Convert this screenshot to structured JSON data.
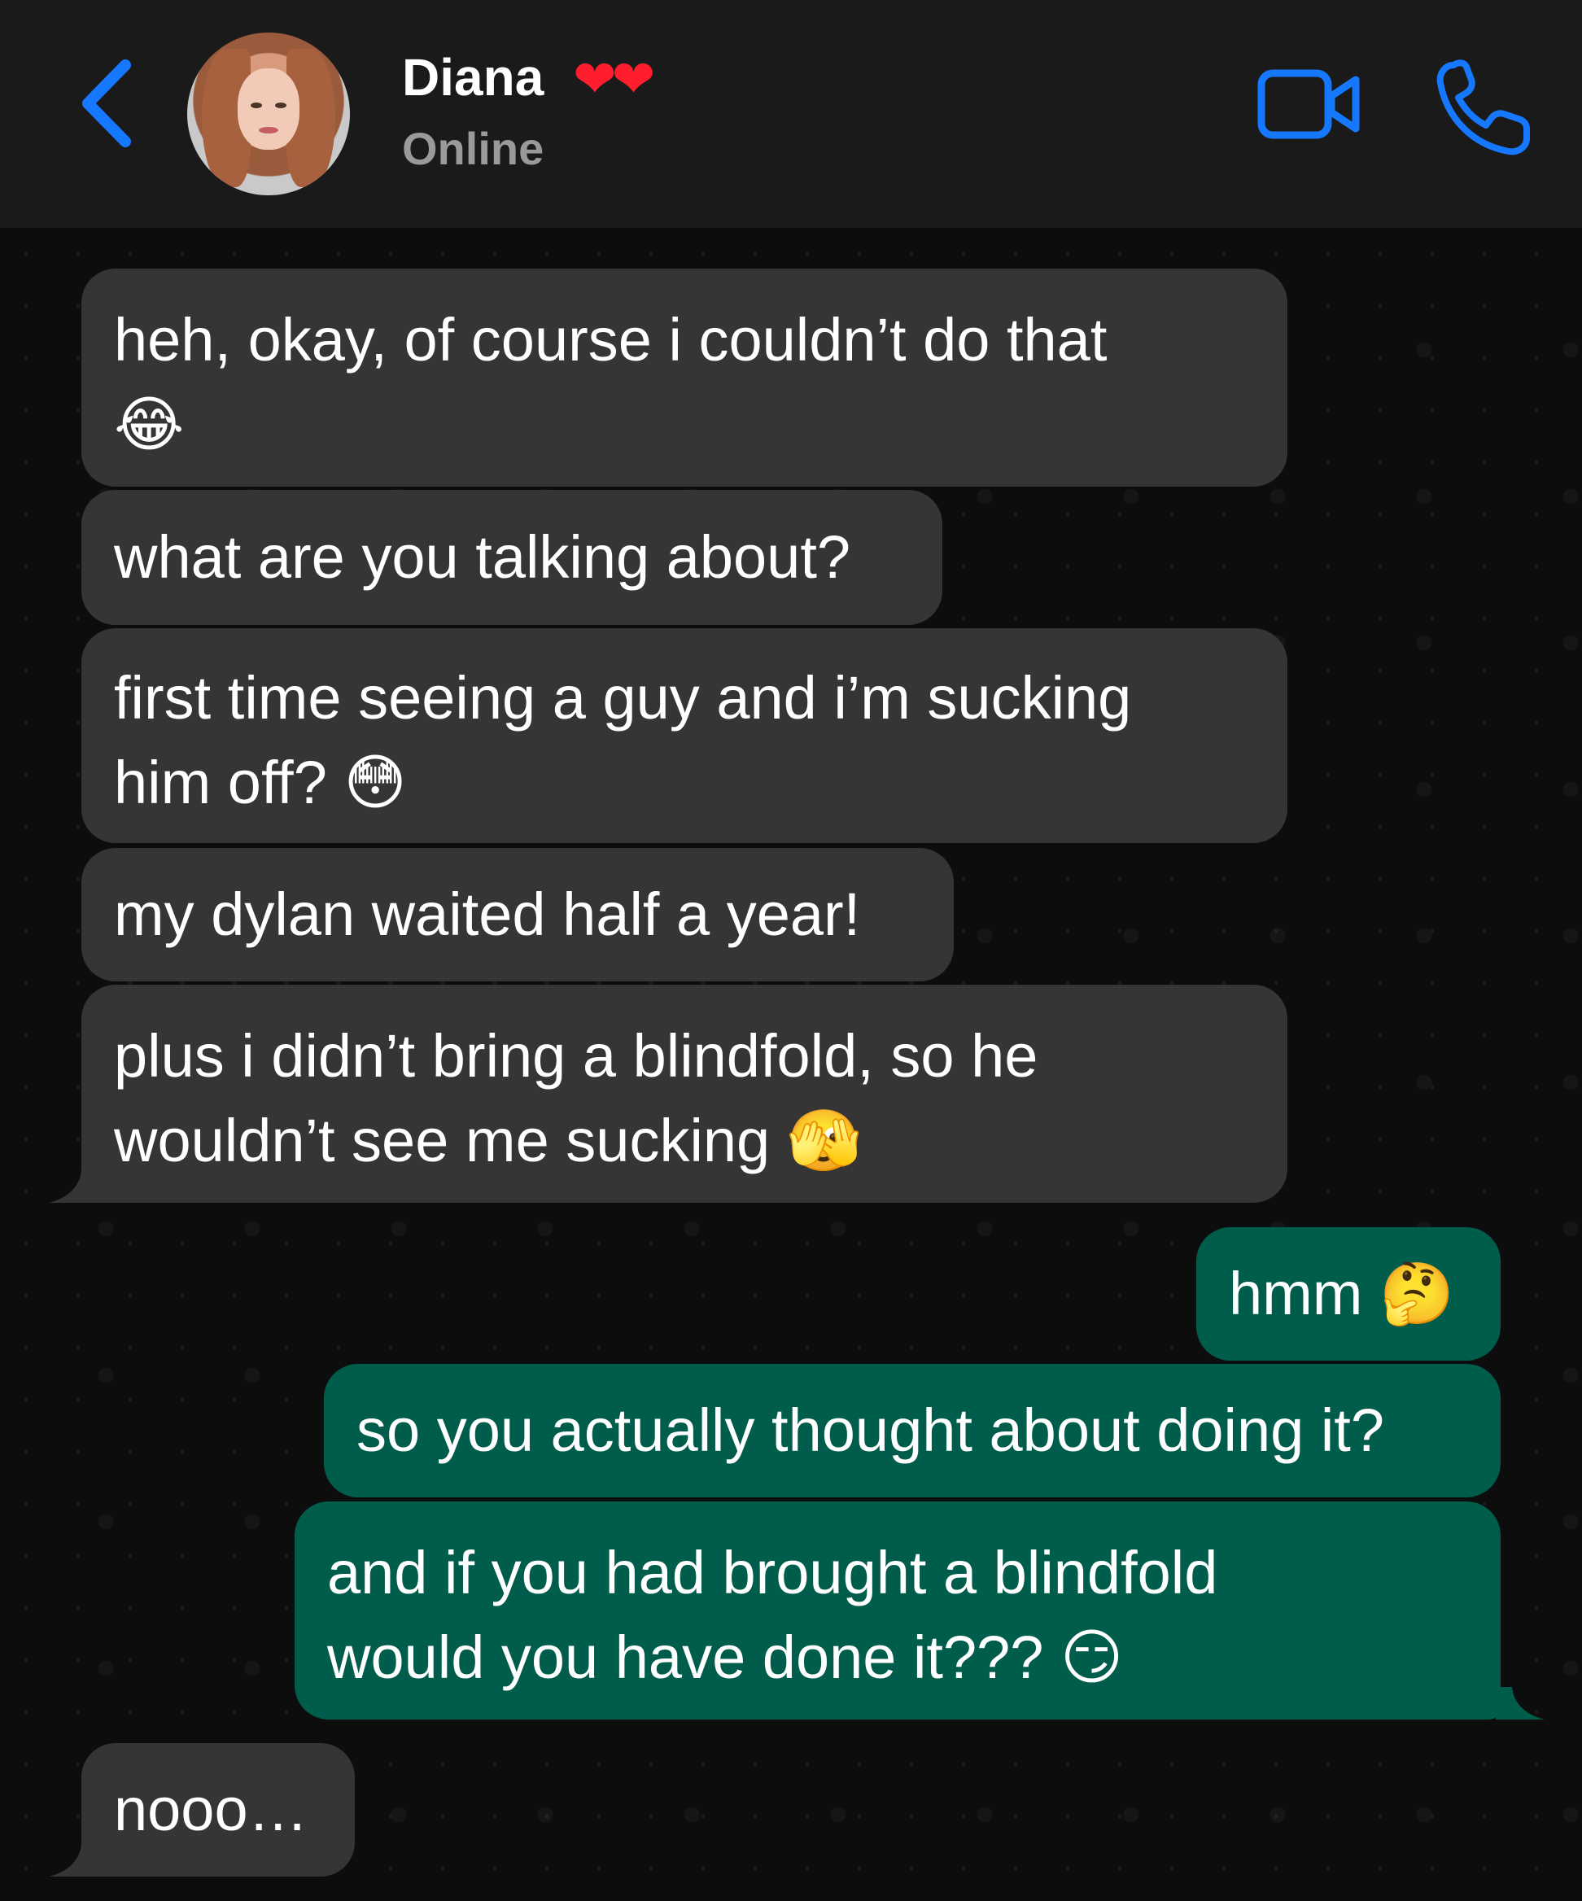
{
  "header": {
    "back_icon": "chevron-left-icon",
    "contact_name": "Diana",
    "name_emoji": "❤❤",
    "status": "Online",
    "video_icon": "video-camera-icon",
    "phone_icon": "phone-icon"
  },
  "colors": {
    "header_bg": "#1a1a1a",
    "accent": "#1677ff",
    "incoming_bubble": "#353535",
    "outgoing_bubble": "#005c4b",
    "chat_bg": "#0d0d0d"
  },
  "messages": [
    {
      "direction": "incoming",
      "text": "heh, okay, of course i couldn’t do that\n😂"
    },
    {
      "direction": "incoming",
      "text": "what are you talking about?"
    },
    {
      "direction": "incoming",
      "text": "first time seeing a guy and i’m sucking\nhim off? 😳"
    },
    {
      "direction": "incoming",
      "text": "my dylan waited half a year!"
    },
    {
      "direction": "incoming",
      "text": "plus i didn’t bring a blindfold, so he\nwouldn’t see me sucking 🫣"
    },
    {
      "direction": "outgoing",
      "text": "hmm 🤔"
    },
    {
      "direction": "outgoing",
      "text": "so you actually thought about doing it?"
    },
    {
      "direction": "outgoing",
      "text": "and if you had brought a blindfold\nwould you have done it??? 😏"
    },
    {
      "direction": "incoming",
      "text": "nooo…"
    }
  ]
}
